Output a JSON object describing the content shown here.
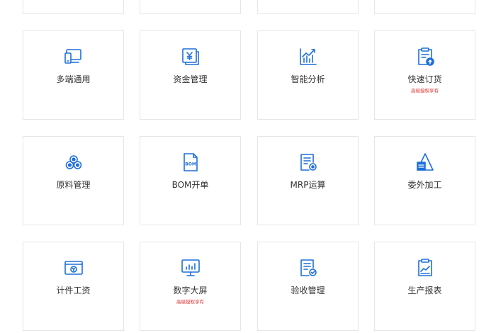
{
  "accent_color": "#1e6fd9",
  "note_color": "#e0312f",
  "tiles": [
    {
      "label": "多端通用",
      "icon": "multi-device-icon",
      "note": ""
    },
    {
      "label": "资金管理",
      "icon": "yuan-ledger-icon",
      "note": ""
    },
    {
      "label": "智能分析",
      "icon": "bar-chart-trend-icon",
      "note": ""
    },
    {
      "label": "快速订货",
      "icon": "clipboard-upload-icon",
      "note": "高级授权享有"
    },
    {
      "label": "原料管理",
      "icon": "material-stack-icon",
      "note": ""
    },
    {
      "label": "BOM开单",
      "icon": "bom-document-icon",
      "note": ""
    },
    {
      "label": "MRP运算",
      "icon": "document-gear-icon",
      "note": ""
    },
    {
      "label": "委外加工",
      "icon": "triangle-block-icon",
      "note": ""
    },
    {
      "label": "计件工资",
      "icon": "wage-card-icon",
      "note": ""
    },
    {
      "label": "数字大屏",
      "icon": "monitor-chart-icon",
      "note": "高级授权享有"
    },
    {
      "label": "验收管理",
      "icon": "document-check-icon",
      "note": ""
    },
    {
      "label": "生产报表",
      "icon": "clipboard-report-icon",
      "note": ""
    }
  ]
}
